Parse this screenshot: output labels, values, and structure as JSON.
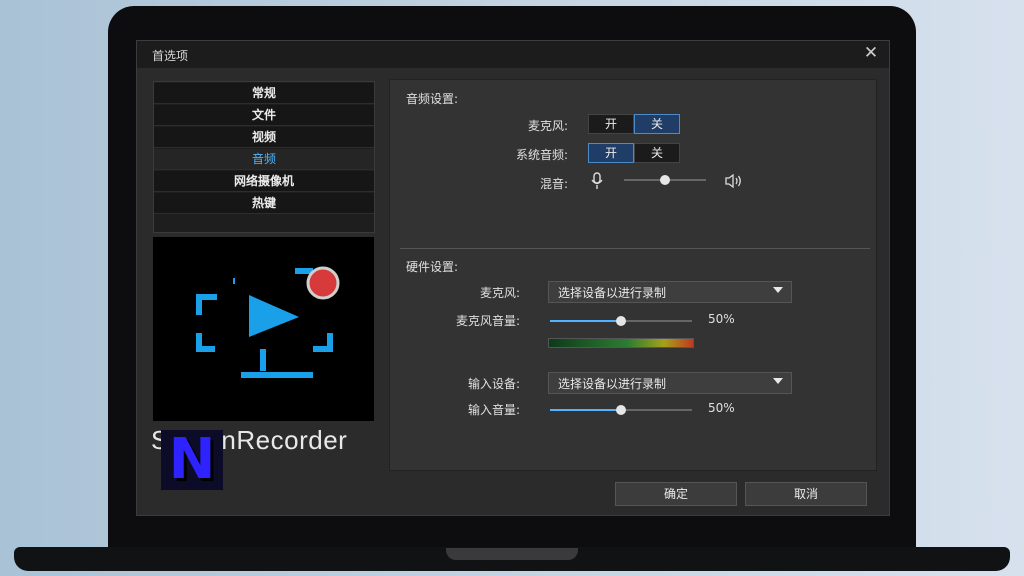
{
  "window": {
    "title": "首选项"
  },
  "nav": {
    "items": [
      {
        "label": "常规"
      },
      {
        "label": "文件"
      },
      {
        "label": "视频"
      },
      {
        "label": "音频",
        "active": true
      },
      {
        "label": "网络摄像机"
      },
      {
        "label": "热键"
      }
    ]
  },
  "brand": {
    "name": "ScreenRecorder",
    "badge": "N"
  },
  "audio_settings": {
    "title": "音频设置:",
    "mic": {
      "label": "麦克风:",
      "on": "开",
      "off": "关",
      "selected": "关"
    },
    "system_audio": {
      "label": "系统音频:",
      "on": "开",
      "off": "关",
      "selected": "开"
    },
    "mix": {
      "label": "混音:",
      "value": 0.5
    }
  },
  "hardware_settings": {
    "title": "硬件设置:",
    "mic_device": {
      "label": "麦克风:",
      "value": "选择设备以进行录制"
    },
    "mic_volume": {
      "label": "麦克风音量:",
      "value": 0.5,
      "text": "50%"
    },
    "input_device": {
      "label": "输入设备:",
      "value": "选择设备以进行录制"
    },
    "input_volume": {
      "label": "输入音量:",
      "value": 0.5,
      "text": "50%"
    }
  },
  "footer": {
    "ok": "确定",
    "cancel": "取消"
  },
  "colors": {
    "accent": "#4db6ff",
    "window_bg": "#2b2b2b",
    "logo_blue": "#1aa0e8",
    "rec_red": "#d63a3a"
  }
}
